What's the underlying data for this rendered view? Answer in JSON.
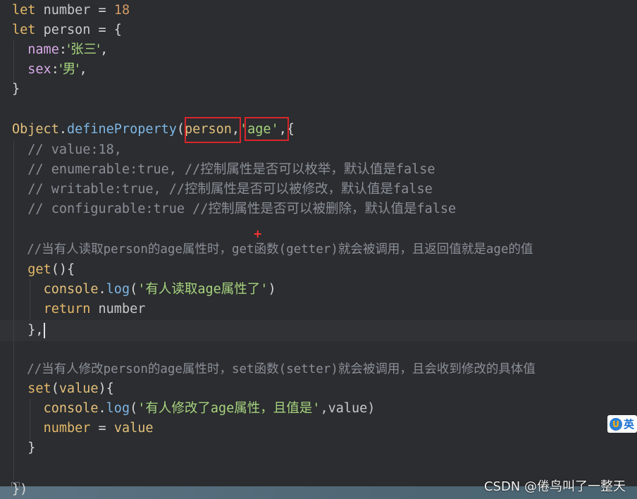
{
  "code": {
    "l1": {
      "kw": "let",
      "name": "number",
      "eq": " = ",
      "val": "18"
    },
    "l2": {
      "kw": "let",
      "name": "person",
      "rest": " = {"
    },
    "l3": {
      "key": "name",
      "colon": ":",
      "val": "'张三'",
      "comma": ","
    },
    "l4": {
      "key": "sex",
      "colon": ":",
      "val": "'男'",
      "comma": ","
    },
    "l5": "}",
    "l7": {
      "obj": "Object",
      "dot": ".",
      "method": "defineProperty",
      "open": "(",
      "arg1": "person",
      "comma1": ",",
      "arg2": "'age'",
      "rest": ",{"
    },
    "l8": "// value:18,",
    "l9": "// enumerable:true, //控制属性是否可以枚举，默认值是false",
    "l10": "// writable:true, //控制属性是否可以被修改，默认值是false",
    "l11": "// configurable:true //控制属性是否可以被删除，默认值是false",
    "l13": "//当有人读取person的age属性时，get函数(getter)就会被调用，且返回值就是age的值",
    "l14": {
      "kw": "get",
      "rest": "(){"
    },
    "l15": {
      "obj": "console",
      "dot": ".",
      "method": "log",
      "open": "(",
      "str": "'有人读取age属性了'",
      "close": ")"
    },
    "l16": {
      "kw": "return",
      "name": " number"
    },
    "l17": "},",
    "l19": "//当有人修改person的age属性时，set函数(setter)就会被调用，且会收到修改的具体值",
    "l20": {
      "kw": "set",
      "open": "(",
      "param": "value",
      "rest": "){"
    },
    "l21": {
      "obj": "console",
      "dot": ".",
      "method": "log",
      "open": "(",
      "str": "'有人修改了age属性，且值是'",
      "rest": ",value)"
    },
    "l22": {
      "name": "number",
      "eq": " = ",
      "val": "value"
    },
    "l23": "}",
    "l25": "})"
  },
  "ime": {
    "label": "英"
  },
  "watermark": "CSDN @倦鸟叫了一整天",
  "colors": {
    "background": "#2b2d30",
    "highlight_box": "#d9262b",
    "keyword": "#e5b96a",
    "function": "#7fb7e6",
    "string": "#a7d37e",
    "comment": "#8a8f98"
  }
}
